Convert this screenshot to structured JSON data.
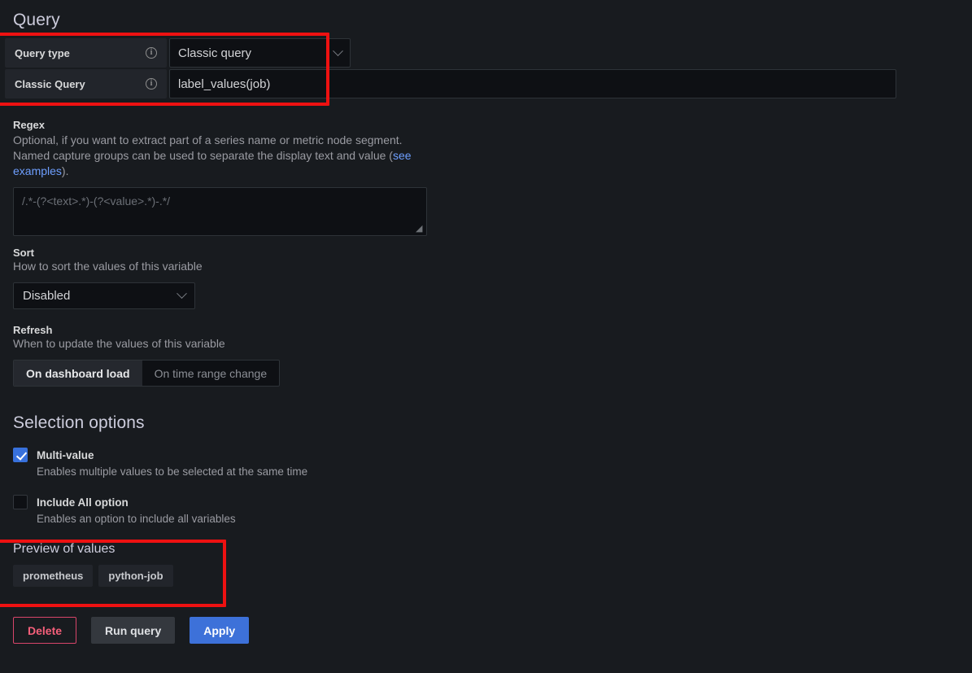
{
  "query_section": {
    "title": "Query",
    "rows": [
      {
        "label": "Query type",
        "info": "info-icon",
        "value": "Classic query",
        "control": "select"
      },
      {
        "label": "Classic Query",
        "info": "info-icon",
        "value": "label_values(job)",
        "control": "input"
      }
    ]
  },
  "regex": {
    "label": "Regex",
    "desc_part1": "Optional, if you want to extract part of a series name or metric node segment. Named capture groups can be used to separate the display text and value (",
    "link_text": "see examples",
    "desc_part2": ").",
    "placeholder": "/.*-(?<text>.*)-(?<value>.*)-.*/",
    "value": ""
  },
  "sort": {
    "label": "Sort",
    "desc": "How to sort the values of this variable",
    "selected": "Disabled"
  },
  "refresh": {
    "label": "Refresh",
    "desc": "When to update the values of this variable",
    "options": [
      "On dashboard load",
      "On time range change"
    ],
    "selected": "On dashboard load"
  },
  "selection_options": {
    "title": "Selection options",
    "items": [
      {
        "label": "Multi-value",
        "desc": "Enables multiple values to be selected at the same time",
        "checked": true
      },
      {
        "label": "Include All option",
        "desc": "Enables an option to include all variables",
        "checked": false
      }
    ]
  },
  "preview": {
    "title": "Preview of values",
    "values": [
      "prometheus",
      "python-job"
    ]
  },
  "buttons": {
    "delete": "Delete",
    "run_query": "Run query",
    "apply": "Apply"
  },
  "colors": {
    "background": "#181b1f",
    "accent_blue": "#3d71d9",
    "checkbox_blue": "#3871dc",
    "link_blue": "#6e9fff",
    "delete_pink": "#f55f7a",
    "annotation_red": "#ee1111",
    "panel": "#22252b",
    "input_bg": "#0e1014"
  }
}
